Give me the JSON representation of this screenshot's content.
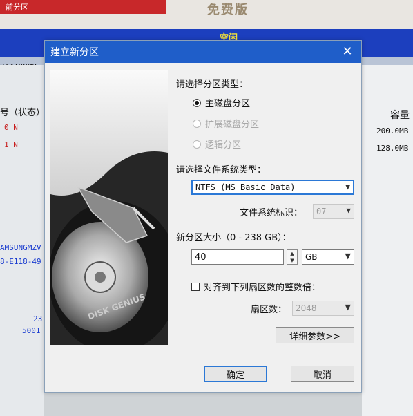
{
  "background": {
    "tab_text": "前分区",
    "logo_text": "免费版",
    "band_label": "空闲",
    "size_text": "244198MB",
    "column_status": "号（状态）",
    "rows": [
      {
        "left": "0 N",
        "size": "200.0MB"
      },
      {
        "left": "1 N",
        "size": "128.0MB"
      }
    ],
    "column_capacity": "容量",
    "disk_model": "AMSUNGMZV",
    "disk_guid": "8-E118-49",
    "num1": "23",
    "num2": "5001"
  },
  "dialog": {
    "title": "建立新分区",
    "close_glyph": "✕",
    "partition_type_label": "请选择分区类型：",
    "partition_types": [
      "主磁盘分区",
      "扩展磁盘分区",
      "逻辑分区"
    ],
    "fs_type_label": "请选择文件系统类型：",
    "fs_type_value": "NTFS (MS Basic Data)",
    "fs_id_label": "文件系统标识：",
    "fs_id_value": "07",
    "size_label": "新分区大小（0 - 238 GB）：",
    "size_value": "40",
    "size_unit": "GB",
    "align_label": "对齐到下列扇区数的整数倍：",
    "sectors_label": "扇区数：",
    "sectors_value": "2048",
    "details_button": "详细参数>>",
    "ok_button": "确定",
    "cancel_button": "取消",
    "hdd_brand": "DISK GENIUS"
  }
}
